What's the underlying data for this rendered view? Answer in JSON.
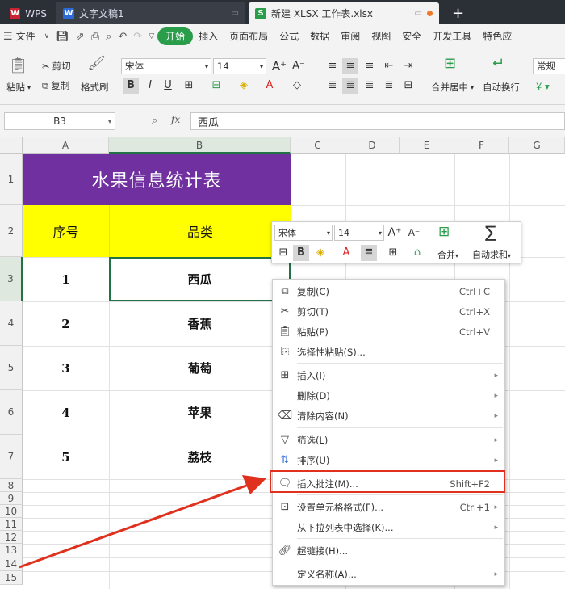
{
  "tabs": [
    {
      "icon": "wps-logo-icon",
      "label": "WPS"
    },
    {
      "icon": "writer-doc-icon",
      "label": "文字文稿1"
    },
    {
      "icon": "spreadsheet-doc-icon",
      "label": "新建 XLSX 工作表.xlsx"
    }
  ],
  "add_tab": "+",
  "menubar": {
    "file": "文件",
    "items": [
      "开始",
      "插入",
      "页面布局",
      "公式",
      "数据",
      "审阅",
      "视图",
      "安全",
      "开发工具",
      "特色应"
    ]
  },
  "ribbon": {
    "paste": "粘贴",
    "cut": "剪切",
    "copy": "复制",
    "format_painter": "格式刷",
    "font_name": "宋体",
    "font_size": "14",
    "bold": "B",
    "italic": "I",
    "underline": "U",
    "merge_center": "合并居中",
    "wrap_text": "自动换行",
    "number_format": "常规"
  },
  "formulabar": {
    "cell_ref": "B3",
    "fx": "fx",
    "value": "西瓜"
  },
  "columns": [
    "A",
    "B",
    "C",
    "D",
    "E",
    "F",
    "G"
  ],
  "rows": [
    "1",
    "2",
    "3",
    "4",
    "5",
    "6",
    "7",
    "8",
    "9",
    "10",
    "11",
    "12",
    "13",
    "14",
    "15"
  ],
  "sheet": {
    "title": "水果信息统计表",
    "header_no": "序号",
    "header_cat": "品类",
    "data": [
      {
        "no": "1",
        "cat": "西瓜"
      },
      {
        "no": "2",
        "cat": "香蕉"
      },
      {
        "no": "3",
        "cat": "葡萄"
      },
      {
        "no": "4",
        "cat": "苹果"
      },
      {
        "no": "5",
        "cat": "荔枝"
      }
    ],
    "title_color": "#7030a0",
    "header_color": "#ffff00"
  },
  "mini_toolbar": {
    "font_name": "宋体",
    "font_size": "14",
    "bold": "B",
    "merge": "合并",
    "autosum": "自动求和"
  },
  "context_menu": [
    {
      "icon": "copy-icon",
      "label": "复制(C)",
      "shortcut": "Ctrl+C"
    },
    {
      "icon": "scissors-icon",
      "label": "剪切(T)",
      "shortcut": "Ctrl+X"
    },
    {
      "icon": "paste-icon",
      "label": "粘贴(P)",
      "shortcut": "Ctrl+V"
    },
    {
      "icon": "paste-special-icon",
      "label": "选择性粘贴(S)...",
      "shortcut": ""
    },
    {
      "icon": "insert-cells-icon",
      "label": "插入(I)",
      "shortcut": "",
      "submenu": true
    },
    {
      "icon": "",
      "label": "删除(D)",
      "shortcut": "",
      "submenu": true
    },
    {
      "icon": "eraser-icon",
      "label": "清除内容(N)",
      "shortcut": "",
      "submenu": true
    },
    {
      "icon": "filter-icon",
      "label": "筛选(L)",
      "shortcut": "",
      "submenu": true
    },
    {
      "icon": "sort-icon",
      "label": "排序(U)",
      "shortcut": "",
      "submenu": true
    },
    {
      "icon": "comment-icon",
      "label": "插入批注(M)...",
      "shortcut": "Shift+F2"
    },
    {
      "icon": "format-cells-icon",
      "label": "设置单元格格式(F)...",
      "shortcut": "Ctrl+1"
    },
    {
      "icon": "",
      "label": "从下拉列表中选择(K)...",
      "shortcut": ""
    },
    {
      "icon": "link-icon",
      "label": "超链接(H)...",
      "shortcut": ""
    },
    {
      "icon": "",
      "label": "定义名称(A)...",
      "shortcut": "",
      "submenu": true
    }
  ],
  "colors": {
    "accent_green": "#2a9d4b",
    "highlight_red": "#e0301e",
    "selection_green": "#217346"
  }
}
